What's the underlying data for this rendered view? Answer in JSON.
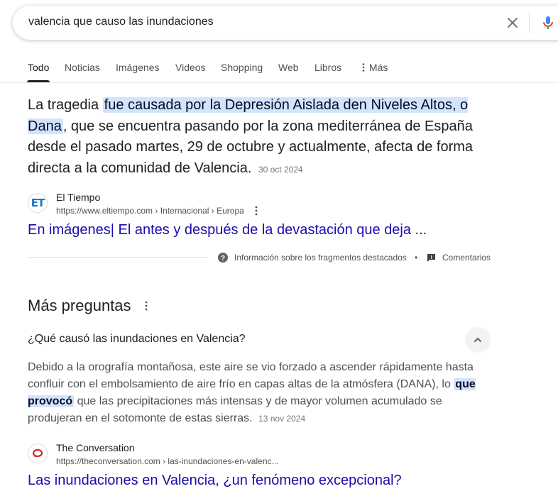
{
  "search": {
    "query": "valencia que causo las inundaciones"
  },
  "tabs": [
    {
      "label": "Todo"
    },
    {
      "label": "Noticias"
    },
    {
      "label": "Imágenes"
    },
    {
      "label": "Videos"
    },
    {
      "label": "Shopping"
    },
    {
      "label": "Web"
    },
    {
      "label": "Libros"
    },
    {
      "label": "Más"
    }
  ],
  "featured": {
    "text_before": "La tragedia ",
    "highlight": "fue causada por la Depresión Aislada den Niveles Altos, o Dana",
    "text_after": ", que se encuentra pasando por la zona mediterránea de España desde el pasado martes, 29 de octubre y actualmente, afecta de forma directa a la comunidad de Valencia.",
    "date": "30 oct 2024",
    "source_name": "El Tiempo",
    "source_url": "https://www.eltiempo.com › Internacional › Europa",
    "favicon_text": "ET",
    "link_title": "En imágenes| El antes y después de la devastación que deja ...",
    "about_label": "Información sobre los fragmentos destacados",
    "separator": "•",
    "feedback_label": "Comentarios"
  },
  "more_questions": {
    "title": "Más preguntas",
    "question": "¿Qué causó las inundaciones en Valencia?",
    "answer_before": "Debido a la orografía montañosa, este aire se vio forzado a ascender rápidamente hasta confluir con el embolsamiento de aire frío en capas altas de la atmósfera (DANA), lo ",
    "answer_highlight": "que provocó",
    "answer_after": " que las precipitaciones más intensas y de mayor volumen acumulado se produjeran en el sotomonte de estas sierras.",
    "date": "13 nov 2024",
    "source_name": "The Conversation",
    "source_url": "https://theconversation.com › las-inundaciones-en-valenc...",
    "link_title": "Las inundaciones en Valencia, ¿un fenómeno excepcional?"
  },
  "colors": {
    "link": "#1a0dab",
    "highlight_bg": "#d3e3fd",
    "text": "#202124",
    "secondary_text": "#4d5156"
  }
}
